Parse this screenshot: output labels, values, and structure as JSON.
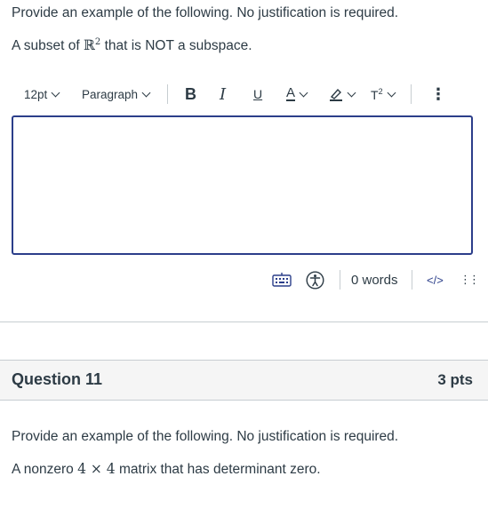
{
  "question10": {
    "instruction": "Provide an example of the following.  No justification is required.",
    "prompt_before": "A subset of ",
    "math_symbol": "ℝ",
    "math_exponent": "2",
    "prompt_after": " that is NOT a subspace."
  },
  "toolbar": {
    "font_size": "12pt",
    "block_format": "Paragraph",
    "bold": "B",
    "italic": "I",
    "underline": "U",
    "text_color": "A",
    "superscript_base": "T",
    "superscript_exp": "2",
    "more": "⋮"
  },
  "editor": {
    "content": ""
  },
  "statusbar": {
    "word_count": "0 words",
    "html_toggle": "</>",
    "resize": "⋮⋮"
  },
  "question11": {
    "title": "Question 11",
    "points": "3 pts",
    "instruction": "Provide an example of the following. No justification is required.",
    "prompt_before": "A nonzero ",
    "math": "4 × 4",
    "prompt_after": " matrix that has determinant zero."
  },
  "colors": {
    "text": "#2d3b45",
    "editor_border": "#2b3e8a",
    "header_bg": "#f5f5f5",
    "divider": "#c7cdd1",
    "html_link": "#2b3e8a"
  }
}
